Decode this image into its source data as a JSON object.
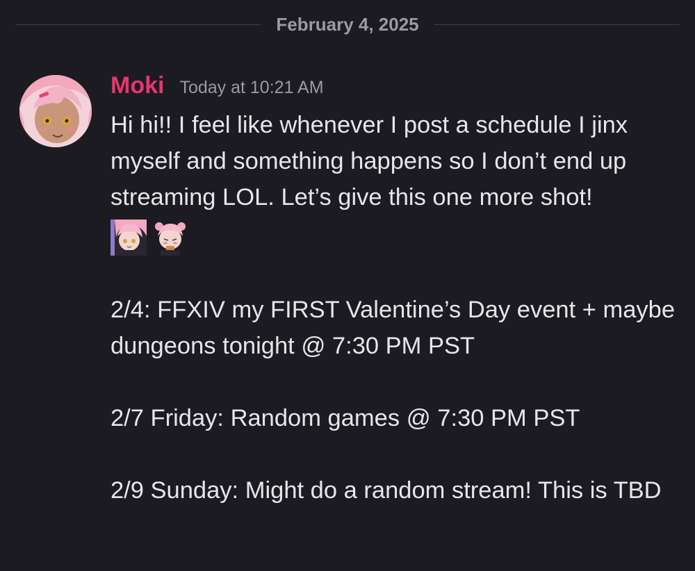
{
  "divider": {
    "date": "February 4, 2025"
  },
  "message": {
    "username": "Moki",
    "timestamp": "Today at 10:21 AM",
    "intro": "Hi hi!! I feel like whenever I post a schedule I jinx myself and something happens so I don’t end up streaming LOL. Let’s give this one more shot!",
    "emotes": [
      "chibi-pink-hair-emote",
      "chibi-pink-hair-blushing-emote"
    ],
    "schedule": [
      "2/4: FFXIV my FIRST Valentine’s Day event + maybe dungeons tonight @ 7:30 PM PST",
      "2/7 Friday: Random games @ 7:30 PM PST",
      "2/9 Sunday: Might do a random stream! This is TBD"
    ]
  },
  "colors": {
    "background": "#1c1b21",
    "username": "#e8356d",
    "muted": "#9a9aa3",
    "text": "#e6e6ea"
  }
}
